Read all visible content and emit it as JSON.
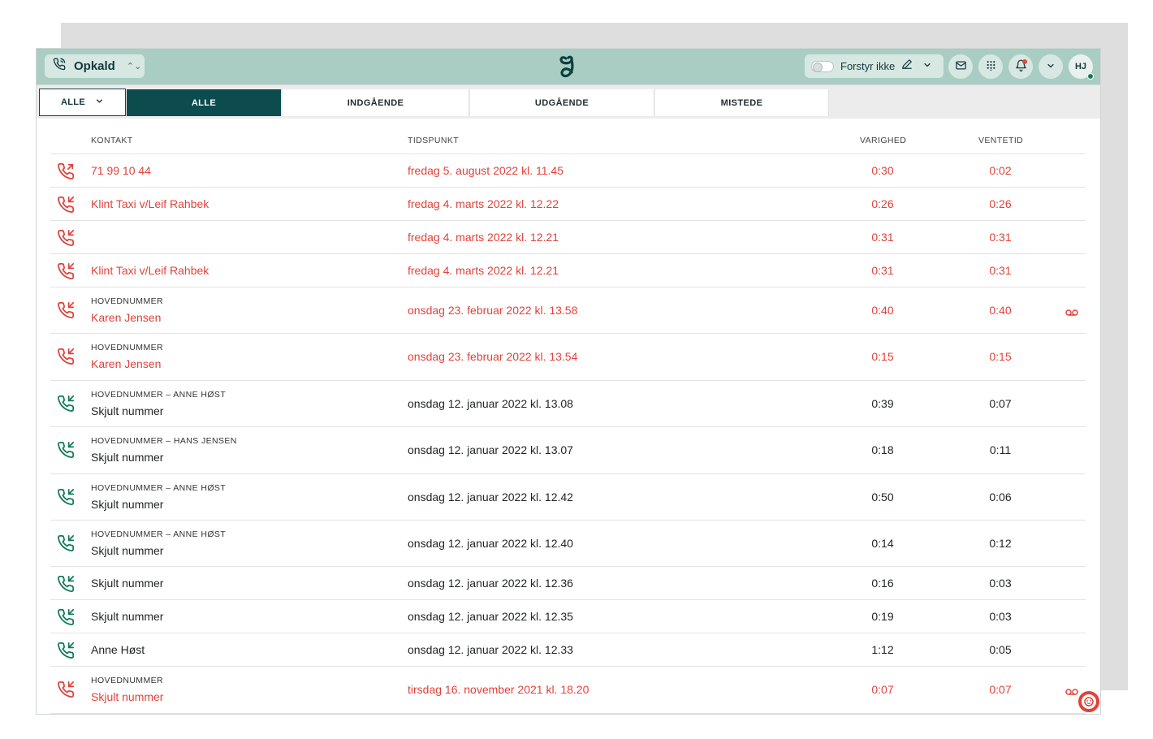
{
  "app": {
    "title": "Opkald",
    "status_label": "Forstyr ikke",
    "avatar_initials": "HJ"
  },
  "filter": {
    "dropdown_label": "ALLE",
    "tabs": [
      {
        "label": "ALLE",
        "active": true
      },
      {
        "label": "INDGÅENDE",
        "active": false
      },
      {
        "label": "UDGÅENDE",
        "active": false
      },
      {
        "label": "MISTEDE",
        "active": false
      }
    ]
  },
  "table": {
    "headers": {
      "contact": "KONTAKT",
      "time": "TIDSPUNKT",
      "duration": "VARIGHED",
      "wait": "VENTETID"
    },
    "rows": [
      {
        "direction": "outgoing",
        "status": "missed",
        "sub": "",
        "name": "71 99 10 44",
        "time": "fredag 5. august 2022 kl. 11.45",
        "duration": "0:30",
        "wait": "0:02",
        "voicemail": false
      },
      {
        "direction": "incoming",
        "status": "missed",
        "sub": "",
        "name": "Klint Taxi v/Leif Rahbek",
        "time": "fredag 4. marts 2022 kl. 12.22",
        "duration": "0:26",
        "wait": "0:26",
        "voicemail": false
      },
      {
        "direction": "incoming",
        "status": "missed",
        "sub": "",
        "name": "",
        "time": "fredag 4. marts 2022 kl. 12.21",
        "duration": "0:31",
        "wait": "0:31",
        "voicemail": false
      },
      {
        "direction": "incoming",
        "status": "missed",
        "sub": "",
        "name": "Klint Taxi v/Leif Rahbek",
        "time": "fredag 4. marts 2022 kl. 12.21",
        "duration": "0:31",
        "wait": "0:31",
        "voicemail": false
      },
      {
        "direction": "incoming",
        "status": "missed",
        "sub": "HOVEDNUMMER",
        "name": "Karen Jensen",
        "time": "onsdag 23. februar 2022 kl. 13.58",
        "duration": "0:40",
        "wait": "0:40",
        "voicemail": true
      },
      {
        "direction": "incoming",
        "status": "missed",
        "sub": "HOVEDNUMMER",
        "name": "Karen Jensen",
        "time": "onsdag 23. februar 2022 kl. 13.54",
        "duration": "0:15",
        "wait": "0:15",
        "voicemail": false
      },
      {
        "direction": "incoming",
        "status": "answered",
        "sub": "HOVEDNUMMER – ANNE HØST",
        "name": "Skjult nummer",
        "time": "onsdag 12. januar 2022 kl. 13.08",
        "duration": "0:39",
        "wait": "0:07",
        "voicemail": false
      },
      {
        "direction": "incoming",
        "status": "answered",
        "sub": "HOVEDNUMMER – HANS JENSEN",
        "name": "Skjult nummer",
        "time": "onsdag 12. januar 2022 kl. 13.07",
        "duration": "0:18",
        "wait": "0:11",
        "voicemail": false
      },
      {
        "direction": "incoming",
        "status": "answered",
        "sub": "HOVEDNUMMER – ANNE HØST",
        "name": "Skjult nummer",
        "time": "onsdag 12. januar 2022 kl. 12.42",
        "duration": "0:50",
        "wait": "0:06",
        "voicemail": false
      },
      {
        "direction": "incoming",
        "status": "answered",
        "sub": "HOVEDNUMMER – ANNE HØST",
        "name": "Skjult nummer",
        "time": "onsdag 12. januar 2022 kl. 12.40",
        "duration": "0:14",
        "wait": "0:12",
        "voicemail": false
      },
      {
        "direction": "incoming",
        "status": "answered",
        "sub": "",
        "name": "Skjult nummer",
        "time": "onsdag 12. januar 2022 kl. 12.36",
        "duration": "0:16",
        "wait": "0:03",
        "voicemail": false
      },
      {
        "direction": "incoming",
        "status": "answered",
        "sub": "",
        "name": "Skjult nummer",
        "time": "onsdag 12. januar 2022 kl. 12.35",
        "duration": "0:19",
        "wait": "0:03",
        "voicemail": false
      },
      {
        "direction": "incoming",
        "status": "answered",
        "sub": "",
        "name": "Anne Høst",
        "time": "onsdag 12. januar 2022 kl. 12.33",
        "duration": "1:12",
        "wait": "0:05",
        "voicemail": false
      },
      {
        "direction": "incoming",
        "status": "missed",
        "sub": "HOVEDNUMMER",
        "name": "Skjult nummer",
        "time": "tirsdag 16. november 2021 kl. 18.20",
        "duration": "0:07",
        "wait": "0:07",
        "voicemail": true
      }
    ]
  },
  "colors": {
    "topbar": "#a9cdc2",
    "active_tab": "#0c4b4e",
    "missed": "#e0423a",
    "answered_icon": "#0f7a5a"
  },
  "icons": {
    "app": "phone-icon",
    "logo": "brand-logo-icon",
    "edit": "pencil-icon",
    "mail": "mail-icon",
    "dialpad": "dialpad-icon",
    "bell": "bell-icon",
    "menu": "chevron-down-icon",
    "voicemail": "voicemail-icon",
    "help": "lifebuoy-icon"
  }
}
